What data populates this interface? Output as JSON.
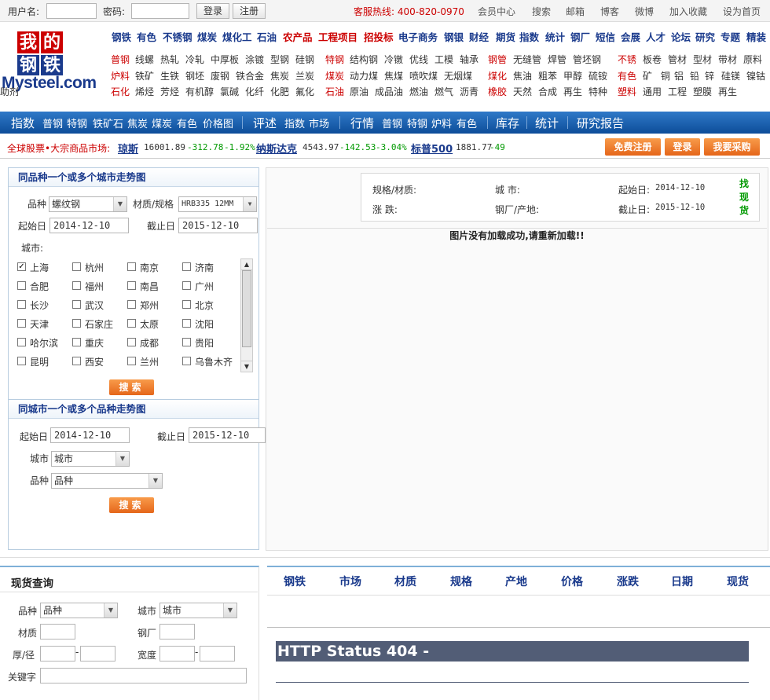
{
  "topbar": {
    "username_label": "用户名:",
    "password_label": "密码:",
    "login_btn": "登录",
    "register_btn": "注册",
    "hotline": "客服热线: 400-820-0970",
    "links": [
      "会员中心",
      "搜索",
      "邮箱",
      "博客",
      "微博",
      "加入收藏",
      "设为首页"
    ]
  },
  "logo": {
    "line1": "我的",
    "line2": "钢铁",
    "brand": "Mysteel.com"
  },
  "nav_main": [
    {
      "t": "钢铁",
      "red": false
    },
    {
      "t": "有色",
      "red": false
    },
    {
      "t": "不锈钢",
      "red": false
    },
    {
      "t": "煤炭",
      "red": false
    },
    {
      "t": "煤化工",
      "red": false
    },
    {
      "t": "石油",
      "red": false
    },
    {
      "t": "农产品",
      "red": true
    },
    {
      "t": "工程项目",
      "red": true
    },
    {
      "t": "招投标",
      "red": true
    },
    {
      "t": "电子商务",
      "red": false
    },
    {
      "t": "钢银",
      "red": false
    },
    {
      "t": "财经",
      "red": false
    },
    {
      "t": "期货",
      "red": false
    },
    {
      "t": "指数",
      "red": false
    },
    {
      "t": "统计",
      "red": false
    },
    {
      "t": "钢厂",
      "red": false
    },
    {
      "t": "短信",
      "red": false
    },
    {
      "t": "会展",
      "red": false
    },
    {
      "t": "人才",
      "red": false
    },
    {
      "t": "论坛",
      "red": false
    },
    {
      "t": "研究",
      "red": false
    },
    {
      "t": "专题",
      "red": false
    },
    {
      "t": "精装",
      "red": false
    }
  ],
  "cat_rows": [
    [
      "普钢",
      "线螺",
      "热轧",
      "冷轧",
      "中厚板",
      "涂镀",
      "型钢",
      "硅钢",
      "特钢",
      "结构钢",
      "冷镦",
      "优线",
      "工模",
      "轴承",
      "钢管",
      "无缝管",
      "焊管",
      "管坯钢",
      "不锈",
      "板卷",
      "管材",
      "型材",
      "带材",
      "原料"
    ],
    [
      "炉料",
      "铁矿",
      "生铁",
      "钢坯",
      "废钢",
      "铁合金",
      "焦炭",
      "兰炭",
      "煤炭",
      "动力煤",
      "焦煤",
      "喷吹煤",
      "无烟煤",
      "煤化",
      "焦油",
      "粗苯",
      "甲醇",
      "硫铵",
      "有色",
      "矿",
      "铜",
      "铝",
      "铅",
      "锌",
      "硅镁",
      "镍钴"
    ],
    [
      "石化",
      "烯烃",
      "芳烃",
      "有机醇",
      "氯碱",
      "化纤",
      "化肥",
      "氟化",
      "石油",
      "原油",
      "成品油",
      "燃油",
      "燃气",
      "沥青",
      "橡胶",
      "天然",
      "合成",
      "再生",
      "特种",
      "塑料",
      "通用",
      "工程",
      "塑膜",
      "再生",
      "助剂"
    ]
  ],
  "bluebar": [
    "指数",
    "普钢",
    "特钢",
    "铁矿石",
    "焦炭",
    "煤炭",
    "有色",
    "价格图",
    "评述",
    "指数",
    "市场",
    "行情",
    "普钢",
    "特钢",
    "炉料",
    "有色",
    "库存",
    "统计",
    "研究报告"
  ],
  "ticker": {
    "label": "全球股票•大宗商品市场:",
    "items": [
      {
        "name": "琼斯",
        "price": "16001.89",
        "chg": "-312.78",
        "pct": "-1.92%"
      },
      {
        "name": "纳斯达克",
        "price": "4543.97",
        "chg": "-142.53",
        "pct": "-3.04%"
      },
      {
        "name": "标普500",
        "price": "1881.77",
        "chg": "-49",
        "pct": ""
      }
    ],
    "buttons": [
      "免费注册",
      "登录",
      "我要采购"
    ]
  },
  "panel1": {
    "title": "同品种一个或多个城市走势图",
    "variety_label": "品种",
    "variety_value": "螺纹钢",
    "spec_label": "材质/规格",
    "spec_value": "HRB335 12MM",
    "start_label": "起始日",
    "start_value": "2014-12-10",
    "end_label": "截止日",
    "end_value": "2015-12-10",
    "city_label": "城市:",
    "cities": [
      "上海",
      "杭州",
      "南京",
      "济南",
      "合肥",
      "福州",
      "南昌",
      "广州",
      "长沙",
      "武汉",
      "郑州",
      "北京",
      "天津",
      "石家庄",
      "太原",
      "沈阳",
      "哈尔滨",
      "重庆",
      "成都",
      "贵阳",
      "昆明",
      "西安",
      "兰州",
      "乌鲁木齐"
    ],
    "search": "搜索"
  },
  "panel2": {
    "title": "同城市一个或多个品种走势图",
    "start_label": "起始日",
    "start_value": "2014-12-10",
    "end_label": "截止日",
    "end_value": "2015-12-10",
    "city_label": "城市",
    "city_value": "城市",
    "variety_label": "品种",
    "variety_value": "品种",
    "search": "搜索"
  },
  "info": {
    "spec_label": "规格/材质:",
    "city_label": "城 市:",
    "start_label": "起始日:",
    "start_value": "2014-12-10",
    "change_label": "涨 跌:",
    "mill_label": "钢厂/产地:",
    "end_label": "截止日:",
    "end_value": "2015-12-10",
    "find_spot": "找现货"
  },
  "chart_area": {
    "message": "图片没有加载成功,请重新加载!!"
  },
  "spot": {
    "title": "现货查询",
    "variety_label": "品种",
    "variety_value": "品种",
    "city_label": "城市",
    "city_value": "城市",
    "material_label": "材质",
    "mill_label": "钢厂",
    "thickness_label": "厚/径",
    "width_label": "宽度",
    "keyword_label": "关键字"
  },
  "result_headers": [
    "钢铁",
    "市场",
    "材质",
    "规格",
    "产地",
    "价格",
    "涨跌",
    "日期",
    "现货"
  ],
  "error": {
    "text": "HTTP Status 404 -"
  },
  "colors": {
    "brand_blue": "#1a3a8c",
    "red": "#cc0000",
    "orange": "#e5661a",
    "up": "#c00",
    "down": "#090"
  }
}
